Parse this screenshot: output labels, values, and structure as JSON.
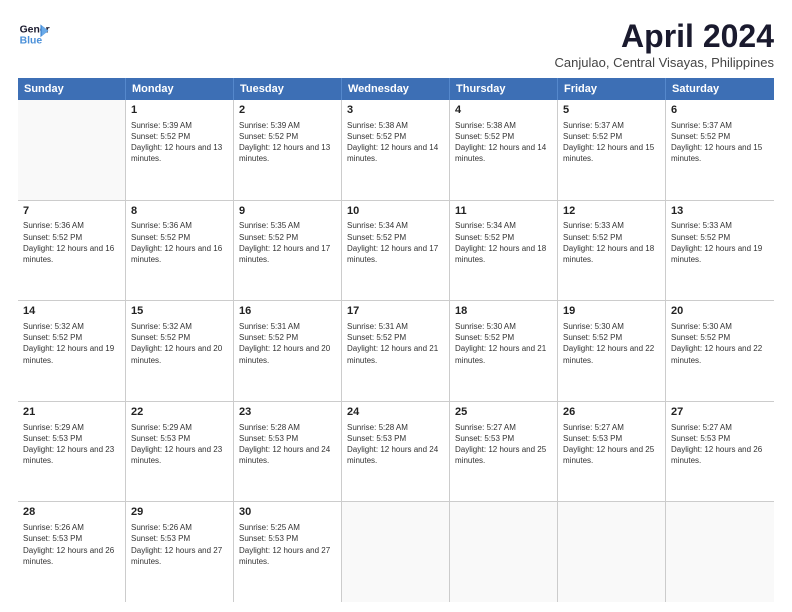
{
  "logo": {
    "line1": "General",
    "line2": "Blue"
  },
  "title": "April 2024",
  "subtitle": "Canjulao, Central Visayas, Philippines",
  "header_days": [
    "Sunday",
    "Monday",
    "Tuesday",
    "Wednesday",
    "Thursday",
    "Friday",
    "Saturday"
  ],
  "weeks": [
    [
      {
        "day": "",
        "sunrise": "",
        "sunset": "",
        "daylight": ""
      },
      {
        "day": "1",
        "sunrise": "5:39 AM",
        "sunset": "5:52 PM",
        "daylight": "12 hours and 13 minutes."
      },
      {
        "day": "2",
        "sunrise": "5:39 AM",
        "sunset": "5:52 PM",
        "daylight": "12 hours and 13 minutes."
      },
      {
        "day": "3",
        "sunrise": "5:38 AM",
        "sunset": "5:52 PM",
        "daylight": "12 hours and 14 minutes."
      },
      {
        "day": "4",
        "sunrise": "5:38 AM",
        "sunset": "5:52 PM",
        "daylight": "12 hours and 14 minutes."
      },
      {
        "day": "5",
        "sunrise": "5:37 AM",
        "sunset": "5:52 PM",
        "daylight": "12 hours and 15 minutes."
      },
      {
        "day": "6",
        "sunrise": "5:37 AM",
        "sunset": "5:52 PM",
        "daylight": "12 hours and 15 minutes."
      }
    ],
    [
      {
        "day": "7",
        "sunrise": "5:36 AM",
        "sunset": "5:52 PM",
        "daylight": "12 hours and 16 minutes."
      },
      {
        "day": "8",
        "sunrise": "5:36 AM",
        "sunset": "5:52 PM",
        "daylight": "12 hours and 16 minutes."
      },
      {
        "day": "9",
        "sunrise": "5:35 AM",
        "sunset": "5:52 PM",
        "daylight": "12 hours and 17 minutes."
      },
      {
        "day": "10",
        "sunrise": "5:34 AM",
        "sunset": "5:52 PM",
        "daylight": "12 hours and 17 minutes."
      },
      {
        "day": "11",
        "sunrise": "5:34 AM",
        "sunset": "5:52 PM",
        "daylight": "12 hours and 18 minutes."
      },
      {
        "day": "12",
        "sunrise": "5:33 AM",
        "sunset": "5:52 PM",
        "daylight": "12 hours and 18 minutes."
      },
      {
        "day": "13",
        "sunrise": "5:33 AM",
        "sunset": "5:52 PM",
        "daylight": "12 hours and 19 minutes."
      }
    ],
    [
      {
        "day": "14",
        "sunrise": "5:32 AM",
        "sunset": "5:52 PM",
        "daylight": "12 hours and 19 minutes."
      },
      {
        "day": "15",
        "sunrise": "5:32 AM",
        "sunset": "5:52 PM",
        "daylight": "12 hours and 20 minutes."
      },
      {
        "day": "16",
        "sunrise": "5:31 AM",
        "sunset": "5:52 PM",
        "daylight": "12 hours and 20 minutes."
      },
      {
        "day": "17",
        "sunrise": "5:31 AM",
        "sunset": "5:52 PM",
        "daylight": "12 hours and 21 minutes."
      },
      {
        "day": "18",
        "sunrise": "5:30 AM",
        "sunset": "5:52 PM",
        "daylight": "12 hours and 21 minutes."
      },
      {
        "day": "19",
        "sunrise": "5:30 AM",
        "sunset": "5:52 PM",
        "daylight": "12 hours and 22 minutes."
      },
      {
        "day": "20",
        "sunrise": "5:30 AM",
        "sunset": "5:52 PM",
        "daylight": "12 hours and 22 minutes."
      }
    ],
    [
      {
        "day": "21",
        "sunrise": "5:29 AM",
        "sunset": "5:53 PM",
        "daylight": "12 hours and 23 minutes."
      },
      {
        "day": "22",
        "sunrise": "5:29 AM",
        "sunset": "5:53 PM",
        "daylight": "12 hours and 23 minutes."
      },
      {
        "day": "23",
        "sunrise": "5:28 AM",
        "sunset": "5:53 PM",
        "daylight": "12 hours and 24 minutes."
      },
      {
        "day": "24",
        "sunrise": "5:28 AM",
        "sunset": "5:53 PM",
        "daylight": "12 hours and 24 minutes."
      },
      {
        "day": "25",
        "sunrise": "5:27 AM",
        "sunset": "5:53 PM",
        "daylight": "12 hours and 25 minutes."
      },
      {
        "day": "26",
        "sunrise": "5:27 AM",
        "sunset": "5:53 PM",
        "daylight": "12 hours and 25 minutes."
      },
      {
        "day": "27",
        "sunrise": "5:27 AM",
        "sunset": "5:53 PM",
        "daylight": "12 hours and 26 minutes."
      }
    ],
    [
      {
        "day": "28",
        "sunrise": "5:26 AM",
        "sunset": "5:53 PM",
        "daylight": "12 hours and 26 minutes."
      },
      {
        "day": "29",
        "sunrise": "5:26 AM",
        "sunset": "5:53 PM",
        "daylight": "12 hours and 27 minutes."
      },
      {
        "day": "30",
        "sunrise": "5:25 AM",
        "sunset": "5:53 PM",
        "daylight": "12 hours and 27 minutes."
      },
      {
        "day": "",
        "sunrise": "",
        "sunset": "",
        "daylight": ""
      },
      {
        "day": "",
        "sunrise": "",
        "sunset": "",
        "daylight": ""
      },
      {
        "day": "",
        "sunrise": "",
        "sunset": "",
        "daylight": ""
      },
      {
        "day": "",
        "sunrise": "",
        "sunset": "",
        "daylight": ""
      }
    ]
  ],
  "labels": {
    "sunrise_prefix": "Sunrise: ",
    "sunset_prefix": "Sunset: ",
    "daylight_prefix": "Daylight: "
  }
}
